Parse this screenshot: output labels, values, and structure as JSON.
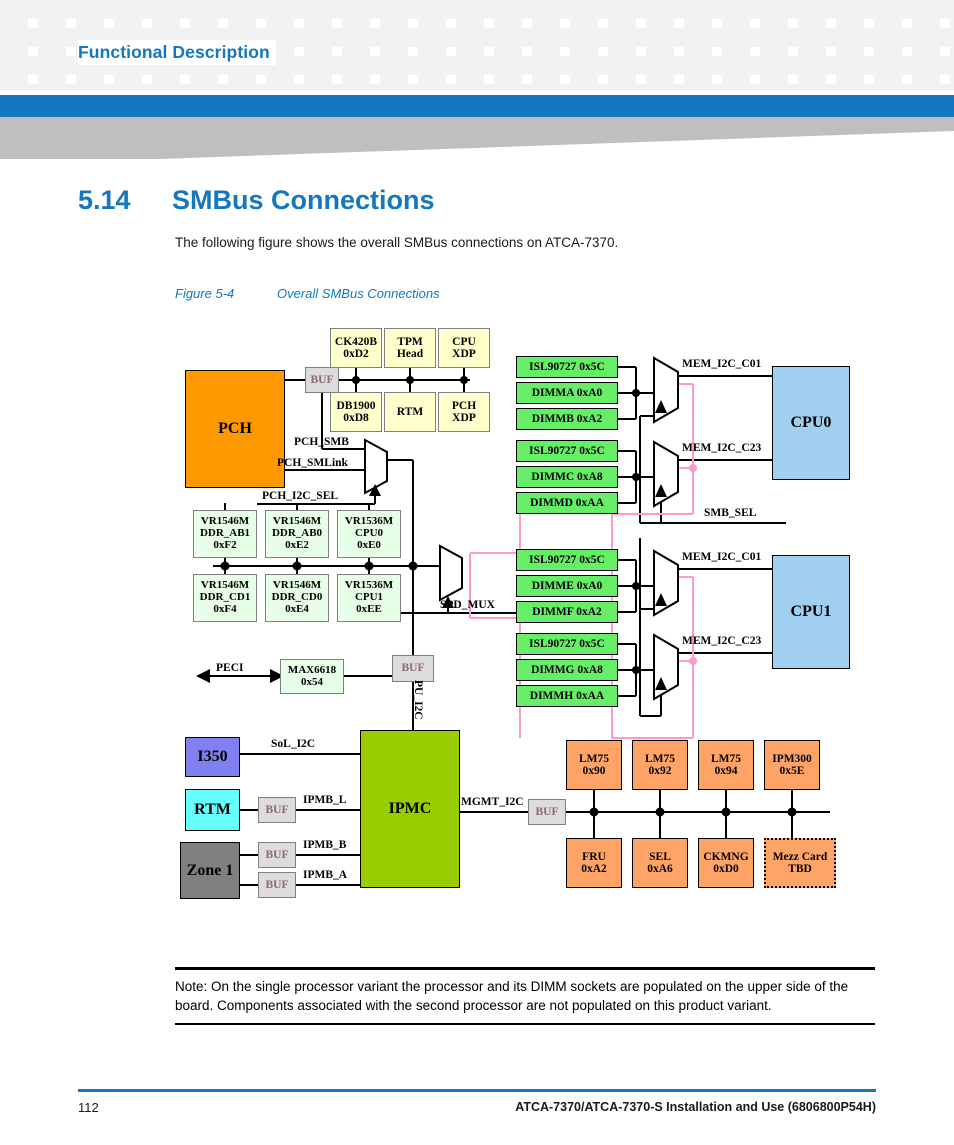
{
  "header": {
    "title": "Functional Description"
  },
  "section": {
    "number": "5.14",
    "title": "SMBus Connections",
    "intro": "The following figure shows the overall SMBus connections on ATCA-7370.",
    "figure_number": "Figure 5-4",
    "figure_caption": "Overall SMBus Connections"
  },
  "colors": {
    "brand_blue": "#1378bd",
    "pch_orange": "#ff9900",
    "cpu_blue": "#a0cff0",
    "ipmc_green": "#9acd00",
    "dimm_green": "#66ee66",
    "vr_green": "#e6ffe6",
    "cream": "#ffffcc",
    "sensor_orange": "#ffa366",
    "buf_gray": "#dcdcdc",
    "i350_purple": "#8080f0",
    "rtm_cyan": "#66ffff",
    "zone1_gray": "#808080",
    "pink_net": "#ff99cc"
  },
  "figure": {
    "pch": {
      "label": "PCH"
    },
    "cpu0": {
      "label": "CPU0"
    },
    "cpu1": {
      "label": "CPU1"
    },
    "ipmc": {
      "label": "IPMC"
    },
    "i350": {
      "label": "I350"
    },
    "rtm_left": {
      "label": "RTM"
    },
    "zone1": {
      "label": "Zone 1"
    },
    "buffers": {
      "pch_buf": "BUF",
      "spd_buf": "BUF",
      "rtm_buf": "BUF",
      "ipmb_b_buf": "BUF",
      "ipmb_a_buf": "BUF",
      "mgmt_buf": "BUF"
    },
    "top_row": [
      {
        "line1": "CK420B",
        "line2": "0xD2"
      },
      {
        "line1": "TPM",
        "line2": "Head"
      },
      {
        "line1": "CPU",
        "line2": "XDP"
      }
    ],
    "second_row": [
      {
        "line1": "DB1900",
        "line2": "0xD8"
      },
      {
        "line1": "RTM",
        "line2": ""
      },
      {
        "line1": "PCH",
        "line2": "XDP"
      }
    ],
    "vr_row1": [
      {
        "line1": "VR1546M",
        "line2": "DDR_AB1",
        "line3": "0xF2"
      },
      {
        "line1": "VR1546M",
        "line2": "DDR_AB0",
        "line3": "0xE2"
      },
      {
        "line1": "VR1536M",
        "line2": "CPU0",
        "line3": "0xE0"
      }
    ],
    "vr_row2": [
      {
        "line1": "VR1546M",
        "line2": "DDR_CD1",
        "line3": "0xF4"
      },
      {
        "line1": "VR1546M",
        "line2": "DDR_CD0",
        "line3": "0xE4"
      },
      {
        "line1": "VR1536M",
        "line2": "CPU1",
        "line3": "0xEE"
      }
    ],
    "max6618": {
      "line1": "MAX6618",
      "line2": "0x54"
    },
    "dimm_group_a": [
      "ISL90727  0x5C",
      "DIMMA  0xA0",
      "DIMMB  0xA2"
    ],
    "dimm_group_b": [
      "ISL90727  0x5C",
      "DIMMC  0xA8",
      "DIMMD  0xAA"
    ],
    "dimm_group_c": [
      "ISL90727  0x5C",
      "DIMME  0xA0",
      "DIMMF  0xA2"
    ],
    "dimm_group_d": [
      "ISL90727  0x5C",
      "DIMMG  0xA8",
      "DIMMH  0xAA"
    ],
    "sensors_top": [
      {
        "line1": "LM75",
        "line2": "0x90"
      },
      {
        "line1": "LM75",
        "line2": "0x92"
      },
      {
        "line1": "LM75",
        "line2": "0x94"
      },
      {
        "line1": "IPM300",
        "line2": "0x5E"
      }
    ],
    "sensors_bottom": [
      {
        "line1": "FRU",
        "line2": "0xA2"
      },
      {
        "line1": "SEL",
        "line2": "0xA6"
      },
      {
        "line1": "CKMNG",
        "line2": "0xD0"
      },
      {
        "line1": "Mezz Card",
        "line2": "TBD"
      }
    ],
    "net_labels": {
      "pch_smb": "PCH_SMB",
      "pch_smlink": "PCH_SMLink",
      "pch_i2c_sel": "PCH_I2C_SEL",
      "spd_mux": "SPD_MUX",
      "peci": "PECI",
      "pu_i2c": "PU_I2C",
      "smb_sel": "SMB_SEL",
      "sol_i2c": "SoL_I2C",
      "ipmb_l": "IPMB_L",
      "ipmb_b": "IPMB_B",
      "ipmb_a": "IPMB_A",
      "mgmt_i2c": "MGMT_I2C",
      "mem_i2c_c01_cpu0": "MEM_I2C_C01",
      "mem_i2c_c23_cpu0": "MEM_I2C_C23",
      "mem_i2c_c01_cpu1": "MEM_I2C_C01",
      "mem_i2c_c23_cpu1": "MEM_I2C_C23"
    }
  },
  "note": {
    "text": "Note:  On the single processor variant the processor and its DIMM sockets are populated on the upper side of the board. Components associated with the second processor are not populated on this product variant."
  },
  "footer": {
    "page": "112",
    "document": "ATCA-7370/ATCA-7370-S Installation and Use (6806800P54H)"
  }
}
